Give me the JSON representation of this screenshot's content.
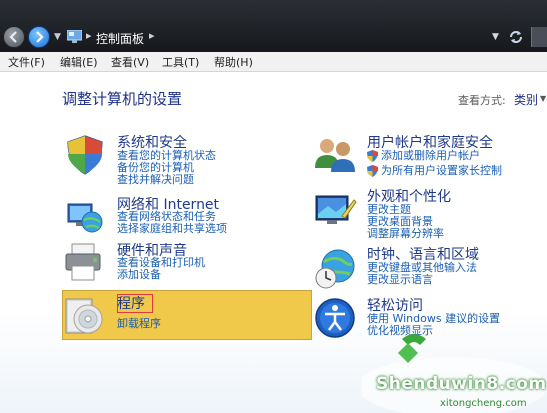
{
  "window": {
    "breadcrumb": "控制面板"
  },
  "menu": {
    "items": [
      "文件(F)",
      "编辑(E)",
      "查看(V)",
      "工具(T)",
      "帮助(H)"
    ]
  },
  "header": {
    "title": "调整计算机的设置",
    "view_by_label": "查看方式:",
    "view_by_value": "类别"
  },
  "categories": {
    "system": {
      "title": "系统和安全",
      "links": [
        "查看您的计算机状态",
        "备份您的计算机",
        "查找并解决问题"
      ]
    },
    "network": {
      "title": "网络和 Internet",
      "links": [
        "查看网络状态和任务",
        "选择家庭组和共享选项"
      ]
    },
    "hardware": {
      "title": "硬件和声音",
      "links": [
        "查看设备和打印机",
        "添加设备"
      ]
    },
    "programs": {
      "title": "程序",
      "links": [
        "卸载程序"
      ]
    },
    "users": {
      "title": "用户帐户和家庭安全",
      "links": [
        "添加或删除用户帐户",
        "为所有用户设置家长控制"
      ]
    },
    "appearance": {
      "title": "外观和个性化",
      "links": [
        "更改主题",
        "更改桌面背景",
        "调整屏幕分辨率"
      ]
    },
    "clock": {
      "title": "时钟、语言和区域",
      "links": [
        "更改键盘或其他输入法",
        "更改显示语言"
      ]
    },
    "ease": {
      "title": "轻松访问",
      "links": [
        "使用 Windows 建议的设置",
        "优化视频显示"
      ]
    }
  },
  "watermark": {
    "text": "Shenduwin8.com",
    "sub": "xitongcheng.com"
  }
}
